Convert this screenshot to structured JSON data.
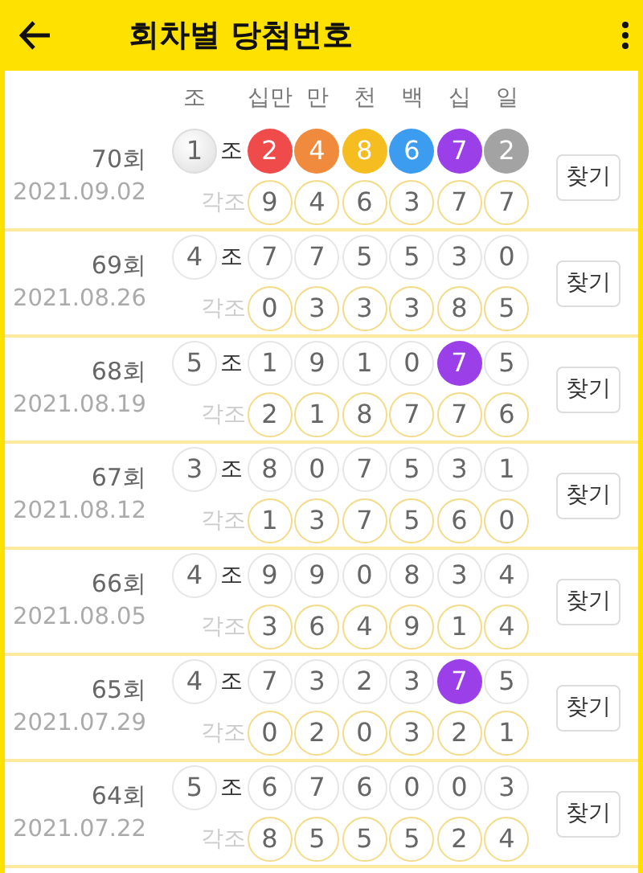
{
  "app_bar": {
    "title": "회차별 당첨번호"
  },
  "columns": {
    "group": "조",
    "digits": [
      "십만",
      "만",
      "천",
      "백",
      "십",
      "일"
    ]
  },
  "draws": [
    {
      "round": "70회",
      "date": "2021.09.02",
      "group": {
        "digit": "1",
        "highlighted": true
      },
      "group_suffix": "조",
      "numbers": [
        {
          "digit": "2",
          "color": "#f04b4b"
        },
        {
          "digit": "4",
          "color": "#f08a3c"
        },
        {
          "digit": "8",
          "color": "#f5bd1f"
        },
        {
          "digit": "6",
          "color": "#3c9df0"
        },
        {
          "digit": "7",
          "color": "#9b3fe8"
        },
        {
          "digit": "2",
          "color": "#a3a3a3"
        }
      ],
      "each_label": "각조",
      "each_numbers": [
        "9",
        "4",
        "6",
        "3",
        "7",
        "7"
      ],
      "button": "찾기"
    },
    {
      "round": "69회",
      "date": "2021.08.26",
      "group": {
        "digit": "4",
        "highlighted": false
      },
      "group_suffix": "조",
      "numbers": [
        {
          "digit": "7"
        },
        {
          "digit": "7"
        },
        {
          "digit": "5"
        },
        {
          "digit": "5"
        },
        {
          "digit": "3"
        },
        {
          "digit": "0"
        }
      ],
      "each_label": "각조",
      "each_numbers": [
        "0",
        "3",
        "3",
        "3",
        "8",
        "5"
      ],
      "button": "찾기"
    },
    {
      "round": "68회",
      "date": "2021.08.19",
      "group": {
        "digit": "5",
        "highlighted": false
      },
      "group_suffix": "조",
      "numbers": [
        {
          "digit": "1"
        },
        {
          "digit": "9"
        },
        {
          "digit": "1"
        },
        {
          "digit": "0"
        },
        {
          "digit": "7",
          "color": "#9b3fe8"
        },
        {
          "digit": "5"
        }
      ],
      "each_label": "각조",
      "each_numbers": [
        "2",
        "1",
        "8",
        "7",
        "7",
        "6"
      ],
      "button": "찾기"
    },
    {
      "round": "67회",
      "date": "2021.08.12",
      "group": {
        "digit": "3",
        "highlighted": false
      },
      "group_suffix": "조",
      "numbers": [
        {
          "digit": "8"
        },
        {
          "digit": "0"
        },
        {
          "digit": "7"
        },
        {
          "digit": "5"
        },
        {
          "digit": "3"
        },
        {
          "digit": "1"
        }
      ],
      "each_label": "각조",
      "each_numbers": [
        "1",
        "3",
        "7",
        "5",
        "6",
        "0"
      ],
      "button": "찾기"
    },
    {
      "round": "66회",
      "date": "2021.08.05",
      "group": {
        "digit": "4",
        "highlighted": false
      },
      "group_suffix": "조",
      "numbers": [
        {
          "digit": "9"
        },
        {
          "digit": "9"
        },
        {
          "digit": "0"
        },
        {
          "digit": "8"
        },
        {
          "digit": "3"
        },
        {
          "digit": "4"
        }
      ],
      "each_label": "각조",
      "each_numbers": [
        "3",
        "6",
        "4",
        "9",
        "1",
        "4"
      ],
      "button": "찾기"
    },
    {
      "round": "65회",
      "date": "2021.07.29",
      "group": {
        "digit": "4",
        "highlighted": false
      },
      "group_suffix": "조",
      "numbers": [
        {
          "digit": "7"
        },
        {
          "digit": "3"
        },
        {
          "digit": "2"
        },
        {
          "digit": "3"
        },
        {
          "digit": "7",
          "color": "#9b3fe8"
        },
        {
          "digit": "5"
        }
      ],
      "each_label": "각조",
      "each_numbers": [
        "0",
        "2",
        "0",
        "3",
        "2",
        "1"
      ],
      "button": "찾기"
    },
    {
      "round": "64회",
      "date": "2021.07.22",
      "group": {
        "digit": "5",
        "highlighted": false
      },
      "group_suffix": "조",
      "numbers": [
        {
          "digit": "6"
        },
        {
          "digit": "7"
        },
        {
          "digit": "6"
        },
        {
          "digit": "0"
        },
        {
          "digit": "0"
        },
        {
          "digit": "3"
        }
      ],
      "each_label": "각조",
      "each_numbers": [
        "8",
        "5",
        "5",
        "5",
        "2",
        "4"
      ],
      "button": "찾기"
    }
  ]
}
